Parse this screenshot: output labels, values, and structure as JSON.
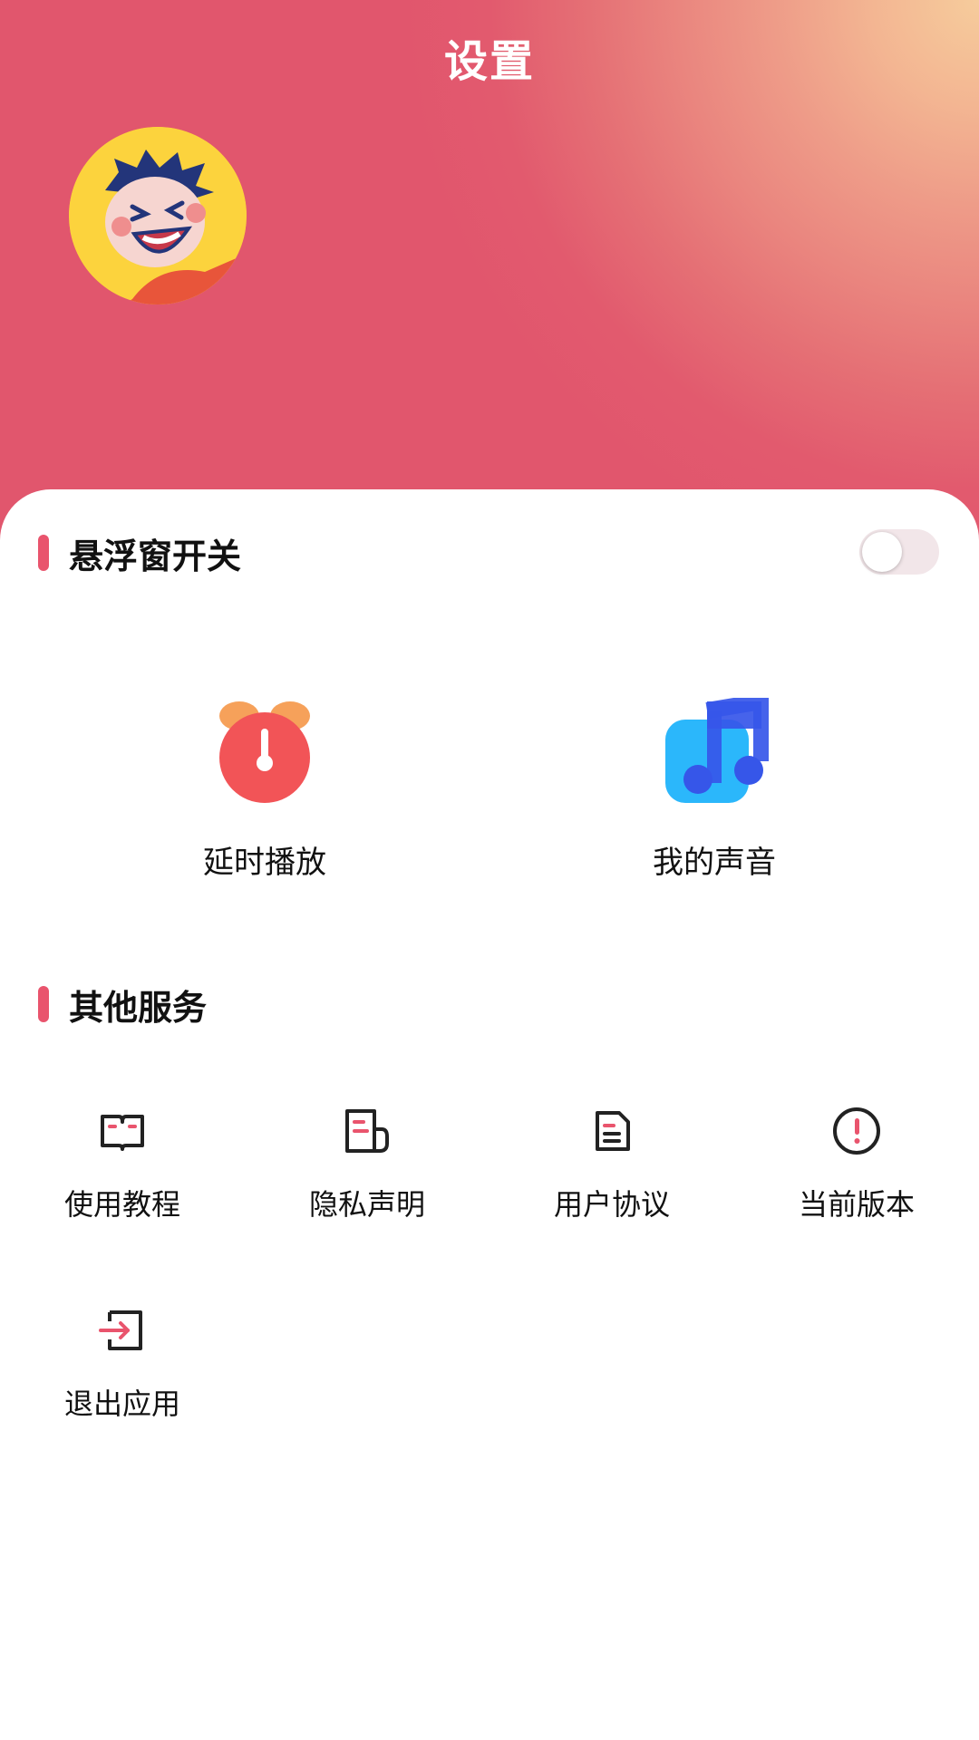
{
  "header": {
    "title": "设置"
  },
  "floating_window": {
    "label": "悬浮窗开关",
    "enabled": false
  },
  "features": [
    {
      "label": "延时播放",
      "icon": "alarm-clock-icon"
    },
    {
      "label": "我的声音",
      "icon": "music-note-icon"
    }
  ],
  "other_services": {
    "title": "其他服务",
    "items": [
      {
        "label": "使用教程",
        "icon": "book-icon"
      },
      {
        "label": "隐私声明",
        "icon": "document-icon"
      },
      {
        "label": "用户协议",
        "icon": "file-text-icon"
      },
      {
        "label": "当前版本",
        "icon": "info-exclamation-icon"
      },
      {
        "label": "退出应用",
        "icon": "exit-icon"
      }
    ]
  },
  "colors": {
    "accent": "#e9546d",
    "header": "#e1566d"
  }
}
